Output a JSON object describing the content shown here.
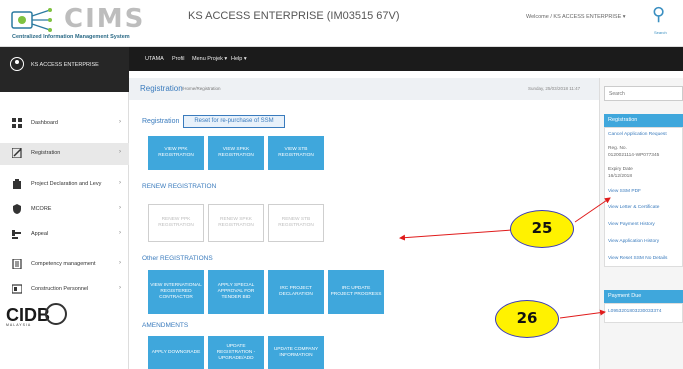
{
  "header": {
    "logo_word": "CIMS",
    "logo_subtitle": "Centralized Information Management System",
    "app_title": "KS ACCESS ENTERPRISE (IM03515 67V)",
    "welcome": "Welcome / KS ACCESS ENTERPRISE ▾",
    "search_label": "Search"
  },
  "topnav": {
    "user_name": "KS ACCESS ENTERPRISE",
    "items": [
      "UTAMA",
      "Profil",
      "Menu Projek ▾",
      "Help ▾"
    ]
  },
  "sidebar": {
    "items": [
      {
        "label": "Dashboard",
        "icon": "dashboard-icon"
      },
      {
        "label": "Registration",
        "icon": "edit-icon"
      },
      {
        "label": "Project Declaration and Levy",
        "icon": "building-icon"
      },
      {
        "label": "MCORE",
        "icon": "shield-icon"
      },
      {
        "label": "Appeal",
        "icon": "gavel-icon"
      },
      {
        "label": "Competency management",
        "icon": "document-icon"
      },
      {
        "label": "Construction Personnel",
        "icon": "id-card-icon"
      }
    ],
    "brand": "CIDB",
    "brand_sub": "MALAYSIA"
  },
  "breadcrumb": {
    "title": "Registration",
    "path": "/Home/Registration",
    "date": "Sunday, 25/03/2018 11:47"
  },
  "main": {
    "registration_label": "Registration",
    "reset_button": "Reset for re-purchase of SSM",
    "view_tiles": [
      "VIEW PPK REGISTRATION",
      "VIEW SPKK REGISTRATION",
      "VIEW STB REGISTRATION"
    ],
    "renew_heading": "RENEW REGISTRATION",
    "renew_tiles": [
      "RENEW PPK REGISTRATION",
      "RENEW SPKK REGISTRATION",
      "RENEW STB REGISTRATION"
    ],
    "other_heading": "Other REGISTRATIONS",
    "other_tiles": [
      "VIEW INTERNATIONAL REGISTERED CONTRACTOR",
      "APPLY SPECIAL APPROVAL FOR TENDER BID",
      "IRC PROJECT DECLARATION",
      "IRC UPDATE PROJECT PROGRESS"
    ],
    "amend_heading": "AMENDMENTS",
    "amend_tiles": [
      "APPLY DOWNGRADE",
      "UPDATE REGISTRATION - UPGRADE/ADD",
      "UPDATE COMPANY INFORMATION"
    ]
  },
  "rightpanel": {
    "search_placeholder": "Search",
    "registration_head": "Registration",
    "cancel_link": "Cancel Application Request",
    "reg_no_label": "Reg. No.",
    "reg_no_value": "0120021114-WP077345",
    "expiry_label": "Expiry Date",
    "expiry_value": "16/12/2018",
    "links": [
      "View SSM PDF",
      "View Letter & Certificate",
      "View Payment History",
      "View Application History",
      "View Reset SSM No Details"
    ],
    "payment_head": "Payment Due",
    "payment_ref": "L0953201803230033374"
  },
  "annotations": {
    "callout_25": "25",
    "callout_26": "26"
  },
  "colors": {
    "accent": "#3fa7dc",
    "link": "#3a7bbd",
    "topbar": "#1b1b1b",
    "callout_fill": "#fff200",
    "arrow": "#e01b1b"
  }
}
